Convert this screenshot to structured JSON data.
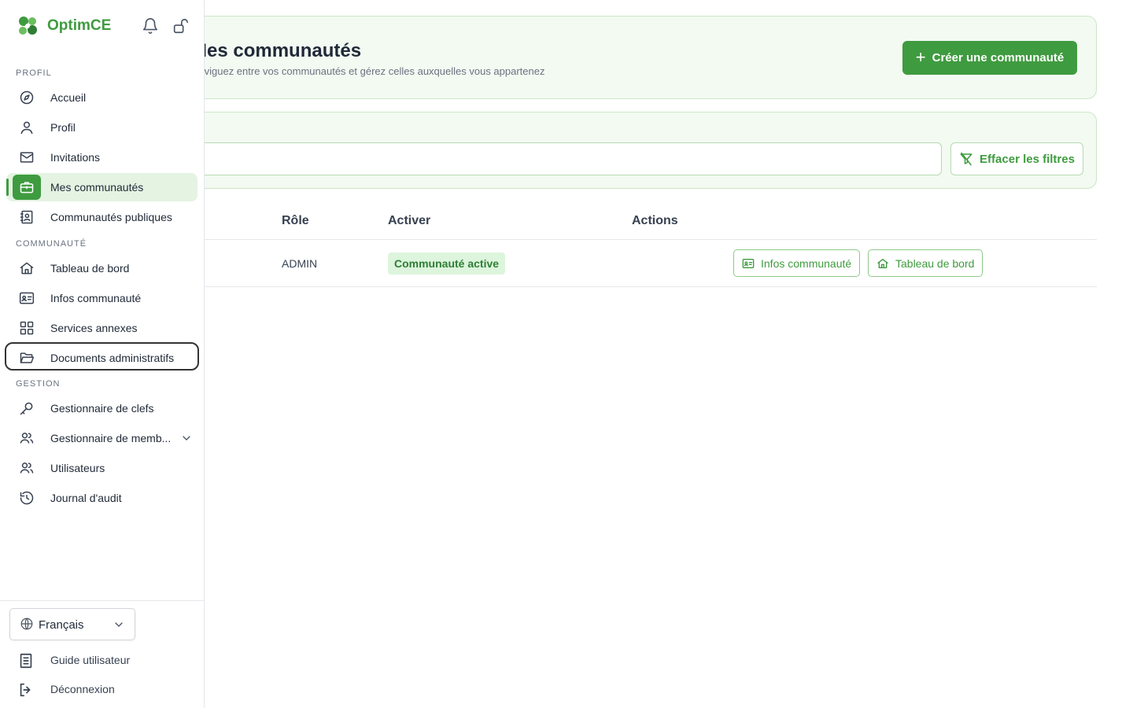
{
  "app": {
    "name": "OptimCE"
  },
  "header": {
    "title": "Mes communautés",
    "subtitle": "Naviguez entre vos communautés et gérez celles auxquelles vous appartenez",
    "create_label": "Créer une communauté"
  },
  "filters": {
    "search_placeholder": "",
    "clear_label": "Effacer les filtres"
  },
  "table": {
    "columns": {
      "name": "",
      "role": "Rôle",
      "activate": "Activer",
      "actions": "Actions"
    },
    "rows": [
      {
        "role": "ADMIN",
        "status": "Communauté active",
        "info_button": "Infos communauté",
        "dashboard_button": "Tableau de bord"
      }
    ]
  },
  "sidebar": {
    "sections": [
      "PROFIL",
      "COMMUNAUTÉ",
      "GESTION"
    ],
    "items": [
      {
        "label": "Accueil",
        "icon": "compass-icon"
      },
      {
        "label": "Profil",
        "icon": "user-icon"
      },
      {
        "label": "Invitations",
        "icon": "mail-icon"
      },
      {
        "label": "Mes communautés",
        "icon": "briefcase-icon",
        "active": true
      },
      {
        "label": "Communautés publiques",
        "icon": "contact-book-icon"
      },
      {
        "label": "Tableau de bord",
        "icon": "home-icon"
      },
      {
        "label": "Infos communauté",
        "icon": "id-card-icon"
      },
      {
        "label": "Services annexes",
        "icon": "grid-icon"
      },
      {
        "label": "Documents administratifs",
        "icon": "folder-open-icon",
        "focused": true
      },
      {
        "label": "Gestionnaire de clefs",
        "icon": "key-icon"
      },
      {
        "label": "Gestionnaire de memb...",
        "icon": "users-icon",
        "expandable": true
      },
      {
        "label": "Utilisateurs",
        "icon": "users-icon"
      },
      {
        "label": "Journal d'audit",
        "icon": "history-icon"
      }
    ],
    "language": "Français",
    "footer": [
      {
        "label": "Guide utilisateur",
        "icon": "book-icon"
      },
      {
        "label": "Déconnexion",
        "icon": "logout-icon"
      }
    ]
  },
  "colors": {
    "brand": "#3f9b3f",
    "active_bg": "#e4f3e2",
    "card_bg": "#f3faf2",
    "badge_bg": "#dcf5dc"
  }
}
